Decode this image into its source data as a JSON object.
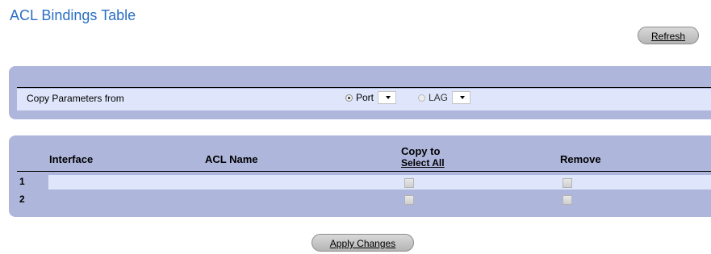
{
  "page": {
    "title": "ACL Bindings Table"
  },
  "toolbar": {
    "refresh_label": "Refresh"
  },
  "copy_parameters": {
    "label": "Copy Parameters from",
    "options": [
      {
        "label": "Port",
        "checked": true,
        "selected_value": ""
      },
      {
        "label": "LAG",
        "checked": false,
        "selected_value": ""
      }
    ]
  },
  "bindings_table": {
    "columns": {
      "interface": "Interface",
      "acl_name": "ACL Name",
      "copy_to": "Copy to",
      "select_all": "Select All",
      "remove": "Remove"
    },
    "rows": [
      {
        "index": "1",
        "interface": "",
        "acl_name": "",
        "copy_to": false,
        "remove": false
      },
      {
        "index": "2",
        "interface": "",
        "acl_name": "",
        "copy_to": false,
        "remove": false
      }
    ]
  },
  "footer": {
    "apply_label": "Apply Changes"
  },
  "colors": {
    "title": "#2a6fc1",
    "panel": "#aeb6dc",
    "band": "#dfe6fb"
  }
}
